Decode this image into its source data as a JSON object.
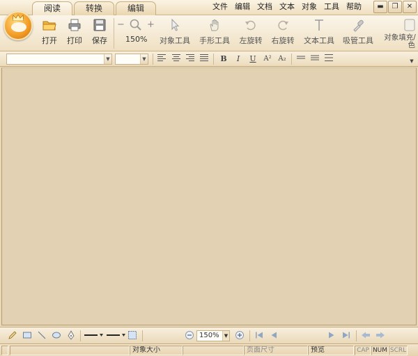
{
  "tabs": [
    {
      "label": "阅读",
      "active": true
    },
    {
      "label": "转换",
      "active": false
    },
    {
      "label": "编辑",
      "active": false
    }
  ],
  "menus": [
    "文件",
    "编辑",
    "文档",
    "文本",
    "对象",
    "工具",
    "帮助"
  ],
  "window_controls": {
    "minimize": "▬",
    "restore": "❐",
    "close": "✕"
  },
  "ribbon": {
    "open": "打开",
    "print": "打印",
    "save": "保存",
    "zoom_out": "−",
    "zoom_in": "+",
    "zoom_level": "150%",
    "object_tool": "对象工具",
    "hand_tool": "手形工具",
    "rotate_left": "左旋转",
    "rotate_right": "右旋转",
    "text_tool": "文本工具",
    "eyedropper_tool": "吸管工具",
    "object_fill_line1": "对象填充/",
    "object_fill_line2": "色"
  },
  "format_bar": {
    "font_name": "",
    "font_size": "",
    "bold": "B",
    "italic": "I",
    "underline": "U",
    "superscript": "A²",
    "subscript": "A₂"
  },
  "bottom_bar": {
    "zoom_value": "150%"
  },
  "status_bar": {
    "left": "",
    "object_size": "对象大小",
    "object_size_value": "",
    "page_size": "页面尺寸",
    "preview": "预览",
    "cap": "CAP",
    "num": "NUM",
    "scrl": "SCRL"
  },
  "colors": {
    "accent": "#f19a24",
    "canvas": "#e2d1b3",
    "chrome": "#efe0c3"
  }
}
